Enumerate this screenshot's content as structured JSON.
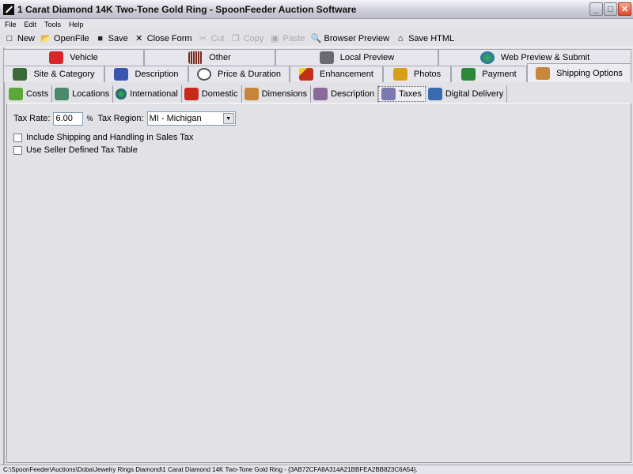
{
  "window": {
    "title": "1 Carat Diamond 14K Two-Tone Gold Ring - SpoonFeeder Auction Software",
    "minimize_label": "_",
    "maximize_label": "□",
    "close_label": "✕"
  },
  "menu": [
    "File",
    "Edit",
    "Tools",
    "Help"
  ],
  "toolbar": {
    "new": {
      "label": "New",
      "icon": "□"
    },
    "open": {
      "label": "OpenFile",
      "icon": "📂"
    },
    "save": {
      "label": "Save",
      "icon": "■"
    },
    "close_form": {
      "label": "Close Form",
      "icon": "✕"
    },
    "cut": {
      "label": "Cut",
      "icon": "✂"
    },
    "copy": {
      "label": "Copy",
      "icon": "❐"
    },
    "paste": {
      "label": "Paste",
      "icon": "▣"
    },
    "browser_preview": {
      "label": "Browser Preview",
      "icon": "🔍"
    },
    "save_html": {
      "label": "Save HTML",
      "icon": "⌂"
    }
  },
  "tabs_row1": [
    {
      "label": "Vehicle",
      "color": "#d8262a"
    },
    {
      "label": "Other",
      "color": "#7a2a1a"
    },
    {
      "label": "Local Preview",
      "color": "#6a6a70"
    },
    {
      "label": "Web Preview & Submit",
      "color": "#1d5ad0"
    }
  ],
  "tabs_row2": [
    {
      "label": "Site & Category",
      "color": "#3a6a3a"
    },
    {
      "label": "Description",
      "color": "#3a54b0"
    },
    {
      "label": "Price & Duration",
      "color": "#555555"
    },
    {
      "label": "Enhancement",
      "color": "#c0601a"
    },
    {
      "label": "Photos",
      "color": "#d8a018"
    },
    {
      "label": "Payment",
      "color": "#2a8a3a"
    },
    {
      "label": "Shipping Options",
      "color": "#c8863a",
      "active": true
    }
  ],
  "subtabs": [
    {
      "label": "Costs",
      "color": "#5aa83a"
    },
    {
      "label": "Locations",
      "color": "#4a8a6a"
    },
    {
      "label": "International",
      "color": "#1a3a8a"
    },
    {
      "label": "Domestic",
      "color": "#c82a1a"
    },
    {
      "label": "Dimensions",
      "color": "#c8863a"
    },
    {
      "label": "Description",
      "color": "#8a6a9a"
    },
    {
      "label": "Taxes",
      "color": "#7a7ab0",
      "active": true
    },
    {
      "label": "Digital Delivery",
      "color": "#3a6ab0"
    }
  ],
  "taxes": {
    "tax_rate_label": "Tax Rate:",
    "tax_rate_value": "6.00",
    "percent_label": "%",
    "tax_region_label": "Tax Region:",
    "tax_region_value": "MI - Michigan",
    "include_shipping_label": "Include Shipping and Handling in Sales Tax",
    "include_shipping_checked": false,
    "seller_table_label": "Use Seller Defined Tax Table",
    "seller_table_checked": false
  },
  "status": "C:\\SpoonFeeder\\Auctions\\Doba\\Jewelry Rings Diamond\\1 Carat Diamond 14K Two-Tone Gold Ring - {3AB72CFA8A314A21BBFEA2BB823C6A54}."
}
